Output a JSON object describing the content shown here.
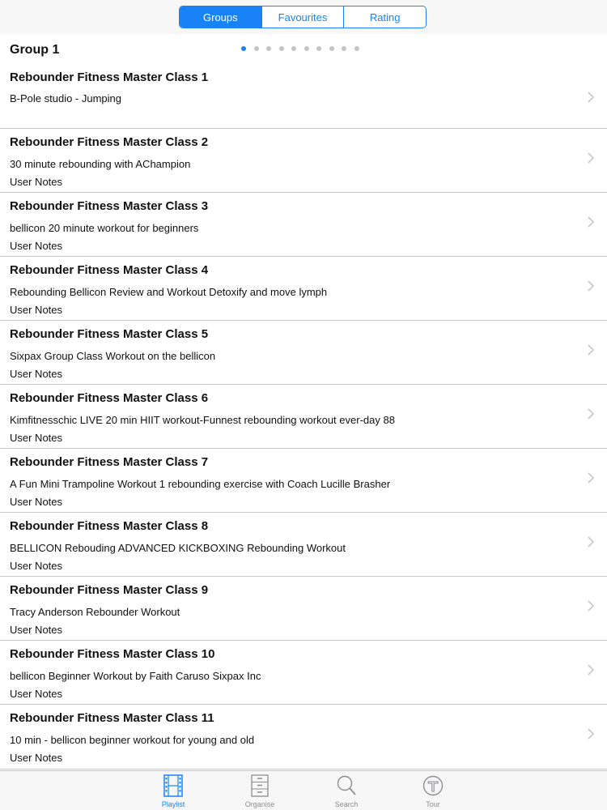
{
  "segments": [
    {
      "label": "Groups",
      "active": true
    },
    {
      "label": "Favourites",
      "active": false
    },
    {
      "label": "Rating",
      "active": false
    }
  ],
  "group": {
    "title": "Group 1",
    "page_count": 10,
    "current_page": 1
  },
  "rows": [
    {
      "title": "Rebounder Fitness Master Class 1",
      "subtitle": "B-Pole studio - Jumping",
      "notes": ""
    },
    {
      "title": "Rebounder Fitness Master Class 2",
      "subtitle": "30 minute rebounding with AChampion",
      "notes": "User Notes"
    },
    {
      "title": "Rebounder Fitness Master Class 3",
      "subtitle": "bellicon 20 minute workout for beginners",
      "notes": "User Notes"
    },
    {
      "title": "Rebounder Fitness Master Class 4",
      "subtitle": "Rebounding  Bellicon Review and Workout Detoxify and move lymph",
      "notes": "User Notes"
    },
    {
      "title": "Rebounder Fitness Master Class 5",
      "subtitle": "Sixpax Group Class Workout on the bellicon",
      "notes": "User Notes"
    },
    {
      "title": "Rebounder Fitness Master Class 6",
      "subtitle": "Kimfitnesschic LIVE 20 min HIIT workout-Funnest rebounding workout ever-day 88",
      "notes": "User Notes"
    },
    {
      "title": "Rebounder Fitness Master Class 7",
      "subtitle": "A Fun Mini Trampoline Workout  1 rebounding exercise with Coach Lucille Brasher",
      "notes": "User Notes"
    },
    {
      "title": "Rebounder Fitness Master Class 8",
      "subtitle": "BELLICON Rebouding ADVANCED KICKBOXING Rebounding Workout",
      "notes": "User Notes"
    },
    {
      "title": "Rebounder Fitness Master Class 9",
      "subtitle": "Tracy Anderson Rebounder Workout",
      "notes": "User Notes"
    },
    {
      "title": "Rebounder Fitness Master Class 10",
      "subtitle": "bellicon Beginner Workout by Faith Caruso Sixpax Inc",
      "notes": "User Notes"
    },
    {
      "title": "Rebounder Fitness Master Class 11",
      "subtitle": "10 min - bellicon beginner workout for young and old",
      "notes": "User Notes"
    }
  ],
  "tabs": [
    {
      "label": "Playlist",
      "icon": "film-icon",
      "active": true
    },
    {
      "label": "Organise",
      "icon": "cabinet-icon",
      "active": false
    },
    {
      "label": "Search",
      "icon": "magnifier-icon",
      "active": false
    },
    {
      "label": "Tour",
      "icon": "tour-icon",
      "active": false
    }
  ],
  "colors": {
    "accent": "#1a82f7",
    "separator": "#c8c7cc",
    "inactive": "#8e8e93"
  }
}
